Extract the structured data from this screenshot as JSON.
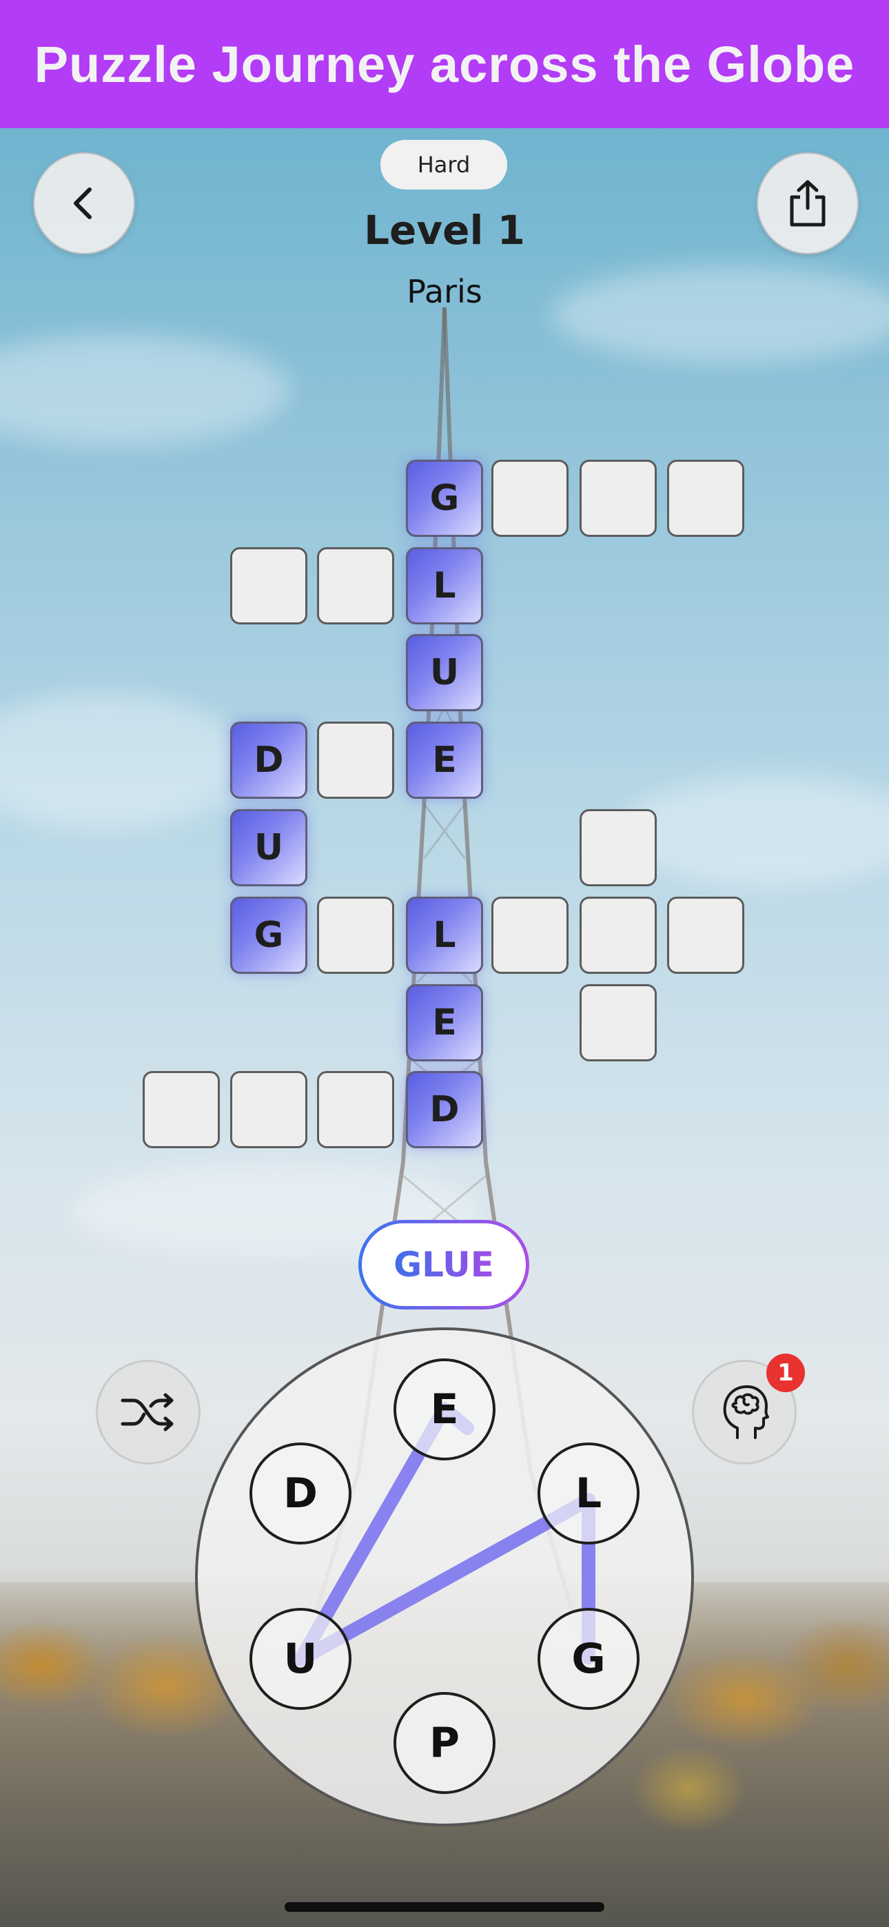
{
  "banner": {
    "title": "Puzzle Journey across the Globe"
  },
  "header": {
    "difficulty": "Hard",
    "level": "Level 1",
    "city": "Paris"
  },
  "grid_letters": {
    "g1": "G",
    "l1": "L",
    "u1": "U",
    "e1": "E",
    "d1": "D",
    "u2": "U",
    "g2": "G",
    "l2": "L",
    "e2": "E",
    "d2": "D"
  },
  "current_word": "GLUE",
  "wheel": {
    "letters": {
      "top": "E",
      "upper_left": "D",
      "upper_right": "L",
      "lower_left": "U",
      "lower_right": "G",
      "bottom": "P"
    }
  },
  "hint": {
    "count": "1"
  },
  "icons": {
    "back": "chevron-left-icon",
    "share": "share-icon",
    "shuffle": "shuffle-icon",
    "hint": "brain-head-icon"
  },
  "colors": {
    "banner": "#b33cf7",
    "filled_cell": "#5a5ee3",
    "trace_line": "#6b64f0",
    "badge": "#e8322f"
  }
}
